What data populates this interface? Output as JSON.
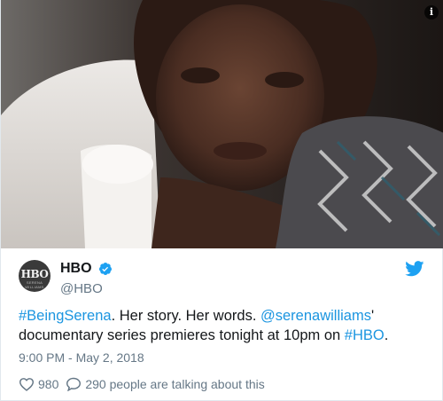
{
  "media": {
    "info_icon": "i"
  },
  "author": {
    "display_name": "HBO",
    "handle": "@HBO",
    "avatar_text": "HBO",
    "avatar_subtext": "SERENA WILLIAMS"
  },
  "tweet": {
    "hashtag": "#BeingSerena",
    "text_part1": ". Her story. Her words. ",
    "mention": "@serenawilliams",
    "text_part2": "' documentary series premieres tonight at 10pm on  ",
    "hashtag2": "#HBO",
    "text_part3": "."
  },
  "timestamp": "9:00 PM - May 2, 2018",
  "actions": {
    "likes": "980",
    "replies_text": "290 people are talking about this"
  },
  "colors": {
    "link": "#1b95e0",
    "muted": "#657786",
    "verified": "#1da1f2"
  },
  "icons": [
    "info-icon",
    "verified-badge-icon",
    "twitter-bird-icon",
    "heart-icon",
    "comment-icon"
  ]
}
